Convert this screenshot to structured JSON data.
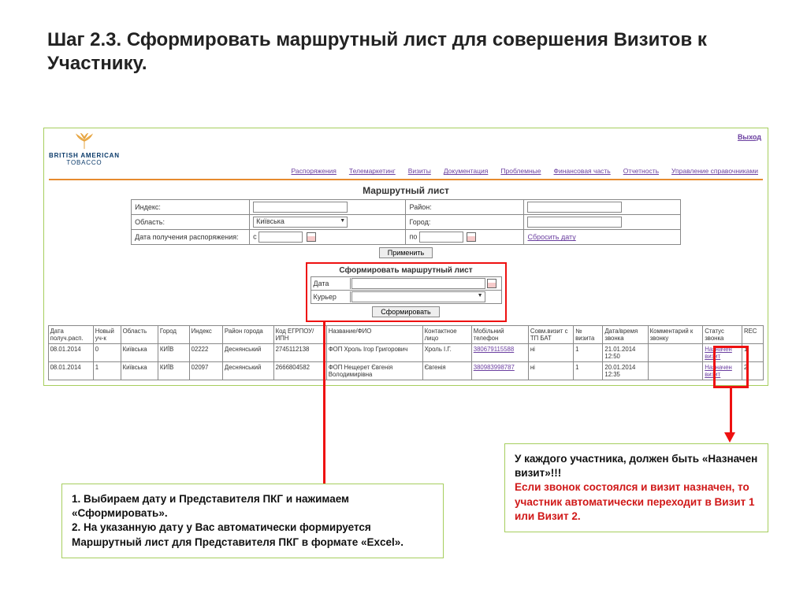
{
  "title": "Шаг 2.3. Сформировать маршрутный лист для совершения Визитов к Участнику.",
  "app": {
    "logo_top": "BRITISH AMERICAN",
    "logo_bottom": "TOBACCO",
    "exit": "Выход",
    "nav": [
      "Распоряжения",
      "Телемаркетинг",
      "Визиты",
      "Документация",
      "Проблемные",
      "Финансовая часть",
      "Отчетность",
      "Управление справочниками"
    ]
  },
  "section_title": "Маршрутный лист",
  "filters": {
    "index": "Индекс:",
    "region_label": "Район:",
    "oblast": "Область:",
    "oblast_value": "Київська",
    "city": "Город:",
    "date_range": "Дата получения распоряжения:",
    "from": "с",
    "to": "по",
    "reset": "Сбросить дату",
    "apply": "Применить"
  },
  "form_box": {
    "title": "Сформировать маршрутный лист",
    "date": "Дата",
    "courier": "Курьер",
    "submit": "Сформировать"
  },
  "table": {
    "headers": [
      "Дата получ.расп.",
      "Новый уч-к",
      "Область",
      "Город",
      "Индекс",
      "Район города",
      "Код ЕГРПОУ/ ИПН",
      "Название/ФИО",
      "Контактное лицо",
      "Мобільний телефон",
      "Совм.визит с ТП БАТ",
      "№ визита",
      "Дата/время звонка",
      "Комментарий к звонку",
      "Статус звонка",
      "REC"
    ],
    "rows": [
      {
        "date": "08.01.2014",
        "new": "0",
        "obl": "Київська",
        "city": "КИЇВ",
        "idx": "02222",
        "district": "Деснянський",
        "code": "2745112138",
        "name": "ФОП Хроль Ігор Григорович",
        "contact": "Хроль І.Г.",
        "phone": "380679115588",
        "joint": "ні",
        "visitno": "1",
        "calldt": "21.01.2014 12:50",
        "comment": "",
        "status": "Назначен визит",
        "rec": "1"
      },
      {
        "date": "08.01.2014",
        "new": "1",
        "obl": "Київська",
        "city": "КИЇВ",
        "idx": "02097",
        "district": "Деснянський",
        "code": "2666804582",
        "name": "ФОП Нещерет Євгенія Володимирівна",
        "contact": "Євгенія",
        "phone": "380983998787",
        "joint": "ні",
        "visitno": "1",
        "calldt": "20.01.2014 12:35",
        "comment": "",
        "status": "Назначен визит",
        "rec": "2"
      }
    ]
  },
  "callout_left": {
    "l1": "1. Выбираем дату и Представителя ПКГ и нажимаем «Сформировать».",
    "l2": "2. На указанную дату у Вас автоматически формируется Маршрутный лист для Представителя ПКГ в формате «Excel»."
  },
  "callout_right": {
    "r1": "У каждого участника, должен быть «Назначен визит»!!!",
    "r2": "Если звонок состоялся и визит назначен, то участник автоматически переходит в Визит 1 или Визит 2."
  }
}
